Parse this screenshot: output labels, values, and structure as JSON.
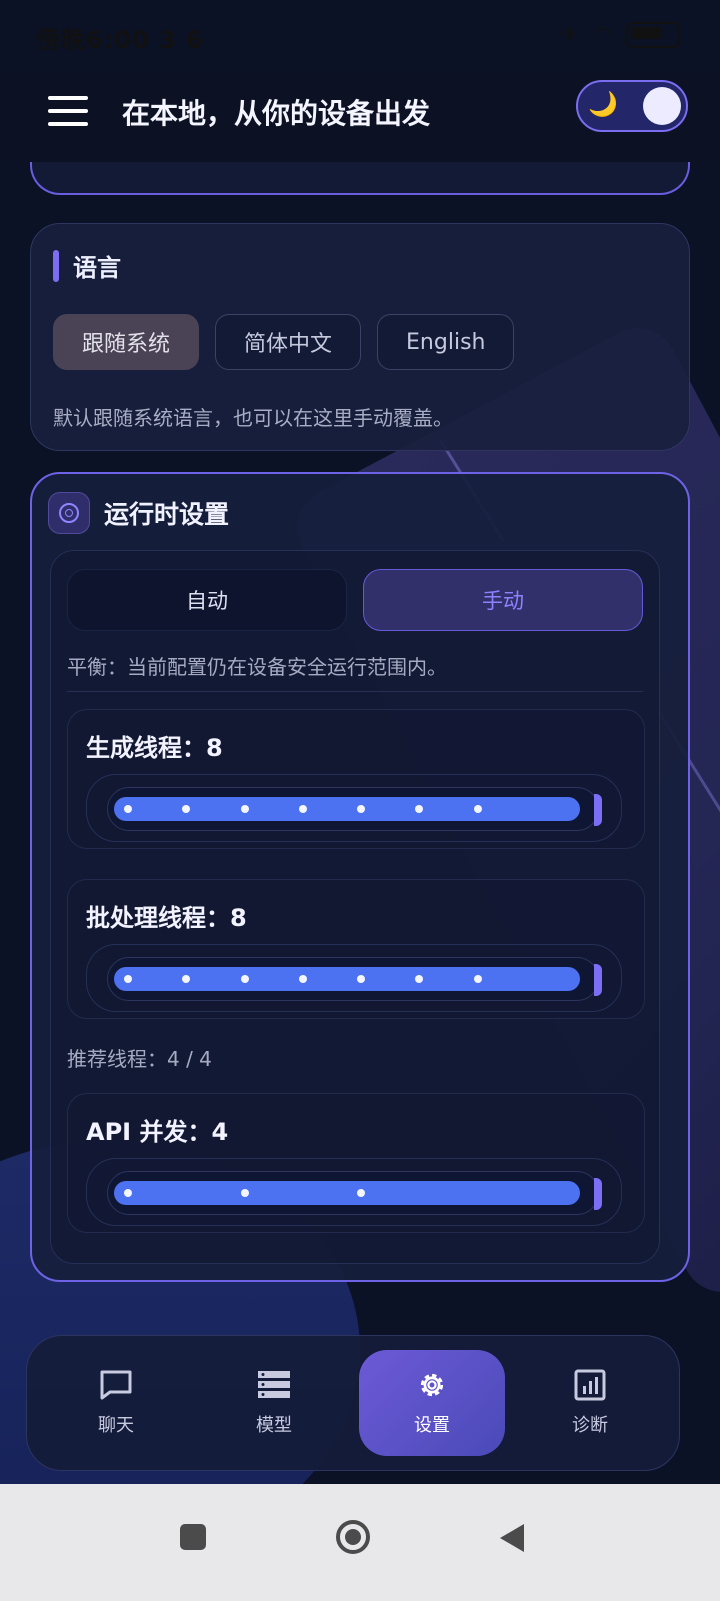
{
  "status_bar": {
    "time": "傍晚6:00 3 6"
  },
  "header": {
    "title": "在本地，从你的设备出发",
    "theme_icon": "moon-icon"
  },
  "language": {
    "title": "语言",
    "options": [
      "跟随系统",
      "简体中文",
      "English"
    ],
    "selected": "跟随系统",
    "hint": "默认跟随系统语言，也可以在这里手动覆盖。"
  },
  "runtime": {
    "title": "运行时设置",
    "modes": [
      "自动",
      "手动"
    ],
    "selected_mode": "手动",
    "status": "平衡：当前配置仍在设备安全运行范围内。",
    "sliders": [
      {
        "label": "生成线程：8",
        "value": 8,
        "max": 8,
        "ticks": 8
      },
      {
        "label": "批处理线程：8",
        "value": 8,
        "max": 8,
        "ticks": 8
      },
      {
        "label": "API 并发：4",
        "value": 4,
        "max": 4,
        "ticks": 4
      }
    ],
    "recommend": "推荐线程：4 / 4"
  },
  "nav": {
    "items": [
      {
        "label": "聊天",
        "icon": "chat-icon"
      },
      {
        "label": "模型",
        "icon": "models-icon"
      },
      {
        "label": "设置",
        "icon": "gear-icon"
      },
      {
        "label": "诊断",
        "icon": "chart-icon"
      }
    ],
    "active": "设置"
  },
  "colors": {
    "accent": "#7d6cf4",
    "slider_fill": "#4c72f2",
    "background": "#0b1226"
  }
}
